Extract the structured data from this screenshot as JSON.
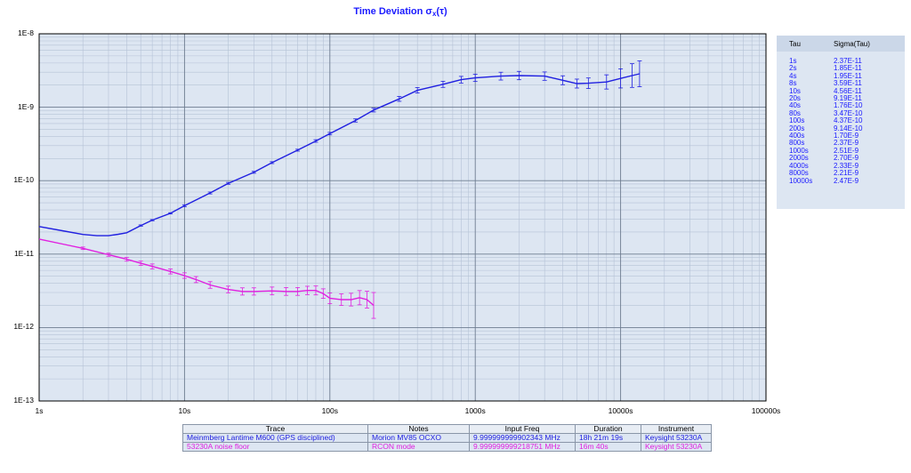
{
  "chart_data": {
    "type": "line",
    "title": "Time Deviation σ",
    "title_sub": "x",
    "title_arg": "(τ)",
    "x_scale": "log",
    "y_scale": "log",
    "xlim": [
      1,
      100000
    ],
    "ylim": [
      1e-13,
      1e-08
    ],
    "x_ticks": [
      "1s",
      "10s",
      "100s",
      "1000s",
      "10000s",
      "100000s"
    ],
    "y_ticks": [
      "1E-8",
      "1E-9",
      "1E-10",
      "1E-11",
      "1E-12",
      "1E-13"
    ],
    "grid": true,
    "series": [
      {
        "name": "Meinmberg Lantime M600 (GPS disciplined)",
        "color": "#2020e0",
        "x": [
          1,
          1.5,
          2,
          2.5,
          3,
          3.5,
          4,
          5,
          6,
          8,
          10,
          15,
          20,
          30,
          40,
          60,
          80,
          100,
          150,
          200,
          300,
          400,
          600,
          800,
          1000,
          1500,
          2000,
          3000,
          4000,
          5000,
          6000,
          8000,
          10000,
          12000,
          13500
        ],
        "y": [
          2.37e-11,
          2.05e-11,
          1.85e-11,
          1.78e-11,
          1.78e-11,
          1.86e-11,
          1.95e-11,
          2.45e-11,
          2.9e-11,
          3.59e-11,
          4.56e-11,
          6.8e-11,
          9.19e-11,
          1.3e-10,
          1.76e-10,
          2.6e-10,
          3.47e-10,
          4.37e-10,
          6.6e-10,
          9.14e-10,
          1.3e-09,
          1.7e-09,
          2.05e-09,
          2.37e-09,
          2.51e-09,
          2.65e-09,
          2.7e-09,
          2.65e-09,
          2.33e-09,
          2.1e-09,
          2.12e-09,
          2.21e-09,
          2.47e-09,
          2.7e-09,
          2.85e-09
        ],
        "err": [
          0,
          0,
          0,
          0,
          0,
          0,
          0,
          0.02,
          0.02,
          0.02,
          0.03,
          0.03,
          0.03,
          0.03,
          0.03,
          0.03,
          0.04,
          0.04,
          0.05,
          0.06,
          0.08,
          0.09,
          0.1,
          0.11,
          0.12,
          0.13,
          0.14,
          0.14,
          0.15,
          0.15,
          0.18,
          0.25,
          0.35,
          0.45,
          0.5
        ]
      },
      {
        "name": "53230A noise floor",
        "color": "#e020e0",
        "x": [
          1,
          1.5,
          2,
          3,
          4,
          5,
          6,
          8,
          10,
          12,
          15,
          20,
          25,
          30,
          40,
          50,
          60,
          70,
          80,
          90,
          100,
          120,
          140,
          160,
          180,
          200
        ],
        "y": [
          1.6e-11,
          1.35e-11,
          1.2e-11,
          9.8e-12,
          8.5e-12,
          7.5e-12,
          6.8e-12,
          5.8e-12,
          5.1e-12,
          4.5e-12,
          3.8e-12,
          3.3e-12,
          3.1e-12,
          3.1e-12,
          3.15e-12,
          3.1e-12,
          3.1e-12,
          3.2e-12,
          3.2e-12,
          2.9e-12,
          2.5e-12,
          2.4e-12,
          2.4e-12,
          2.55e-12,
          2.4e-12,
          2e-12
        ],
        "err": [
          0,
          0,
          0.04,
          0.05,
          0.06,
          0.07,
          0.08,
          0.08,
          0.09,
          0.1,
          0.11,
          0.11,
          0.12,
          0.12,
          0.13,
          0.13,
          0.13,
          0.14,
          0.15,
          0.16,
          0.18,
          0.2,
          0.22,
          0.25,
          0.3,
          0.5
        ]
      }
    ]
  },
  "tau_table": {
    "headers": [
      "Tau",
      "Sigma(Tau)"
    ],
    "rows": [
      [
        "1s",
        "2.37E-11"
      ],
      [
        "2s",
        "1.85E-11"
      ],
      [
        "4s",
        "1.95E-11"
      ],
      [
        "8s",
        "3.59E-11"
      ],
      [
        "10s",
        "4.56E-11"
      ],
      [
        "20s",
        "9.19E-11"
      ],
      [
        "40s",
        "1.76E-10"
      ],
      [
        "80s",
        "3.47E-10"
      ],
      [
        "100s",
        "4.37E-10"
      ],
      [
        "200s",
        "9.14E-10"
      ],
      [
        "400s",
        "1.70E-9"
      ],
      [
        "800s",
        "2.37E-9"
      ],
      [
        "1000s",
        "2.51E-9"
      ],
      [
        "2000s",
        "2.70E-9"
      ],
      [
        "4000s",
        "2.33E-9"
      ],
      [
        "8000s",
        "2.21E-9"
      ],
      [
        "10000s",
        "2.47E-9"
      ]
    ]
  },
  "legend": {
    "headers": [
      "Trace",
      "Notes",
      "Input Freq",
      "Duration",
      "Instrument"
    ],
    "rows": [
      {
        "color": "#2020e0",
        "trace": "Meinmberg Lantime M600 (GPS disciplined)",
        "notes": "Morion MV85 OCXO",
        "freq": "9.999999999902343 MHz",
        "duration": "18h 21m 19s",
        "instrument": "Keysight 53230A"
      },
      {
        "color": "#e020e0",
        "trace": "53230A noise floor",
        "notes": "RCON mode",
        "freq": "9.999999999218751 MHz",
        "duration": "16m 40s",
        "instrument": "Keysight 53230A"
      }
    ]
  }
}
